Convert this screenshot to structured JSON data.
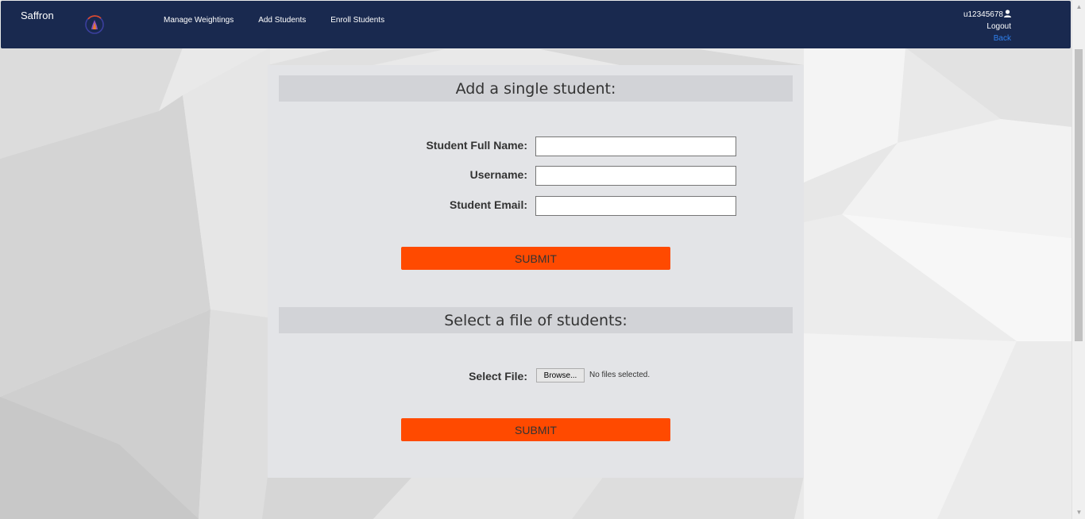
{
  "navbar": {
    "brand": "Saffron",
    "links": [
      {
        "label": "Manage Weightings"
      },
      {
        "label": "Add Students"
      },
      {
        "label": "Enroll Students"
      }
    ],
    "user": {
      "username": "u12345678",
      "logout_label": "Logout",
      "back_label": "Back"
    }
  },
  "single_student": {
    "heading": "Add a single student:",
    "fields": {
      "full_name": {
        "label": "Student Full Name:",
        "value": "",
        "placeholder": ""
      },
      "username": {
        "label": "Username:",
        "value": "",
        "placeholder": ""
      },
      "email": {
        "label": "Student Email:",
        "value": "",
        "placeholder": ""
      }
    },
    "submit_label": "SUBMIT"
  },
  "file_upload": {
    "heading": "Select a file of students:",
    "label": "Select File:",
    "browse_label": "Browse...",
    "status": "No files selected.",
    "submit_label": "SUBMIT"
  },
  "colors": {
    "navbar_bg": "#19294f",
    "accent": "#ff4a00",
    "link": "#2f80ed",
    "panel_bg": "#e3e4e7",
    "heading_bg": "#d2d3d7"
  },
  "icons": {
    "logo": "saffron-logo-icon",
    "user": "user-icon"
  }
}
